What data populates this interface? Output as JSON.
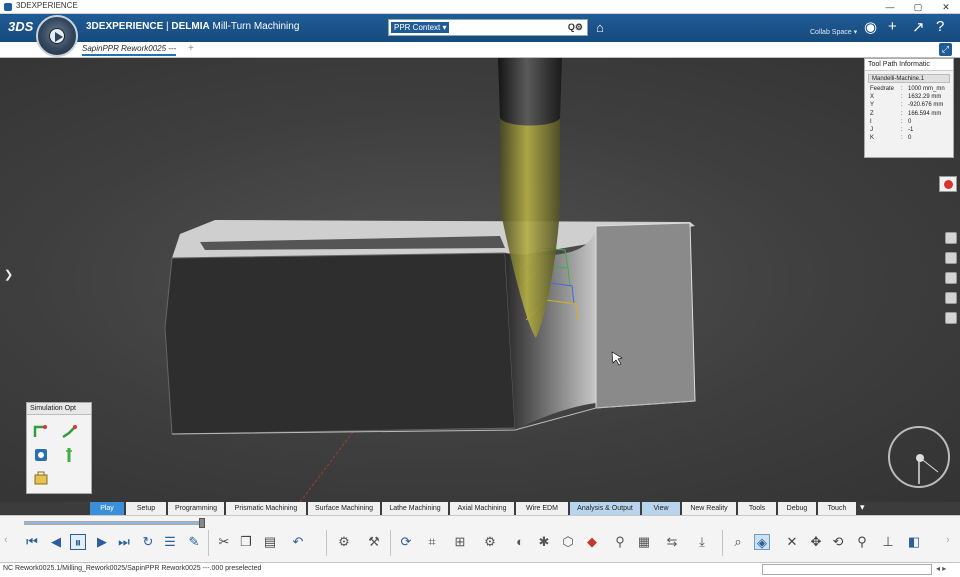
{
  "window": {
    "title": "3DEXPERIENCE",
    "minimize": "—",
    "maximize": "▢",
    "close": "✕"
  },
  "header": {
    "brand_logo": "3DS",
    "brand": "3DEXPERIENCE",
    "separator": " | ",
    "product": "DELMIA",
    "app": " Mill-Turn Machining",
    "search_context": "PPR Context ▾",
    "search_placeholder": "",
    "search_icon": "Q⚙",
    "collab_space": "Collab Space ▾"
  },
  "tabs": {
    "document": "SapinPPR Rework0025 ---",
    "add": "+"
  },
  "tool_path_panel": {
    "title": "Tool Path Informatic",
    "machine": "Mandelli-Machine.1",
    "rows": [
      {
        "label": "Feedrate",
        "colon": ":",
        "value": "1000 mm_mn"
      },
      {
        "label": "X",
        "colon": ":",
        "value": "1632.29 mm"
      },
      {
        "label": "Y",
        "colon": ":",
        "value": "-920.676 mm"
      },
      {
        "label": "Z",
        "colon": ":",
        "value": "166.594 mm"
      },
      {
        "label": "I",
        "colon": ":",
        "value": "0"
      },
      {
        "label": "J",
        "colon": ":",
        "value": "-1"
      },
      {
        "label": "K",
        "colon": ":",
        "value": "0"
      }
    ]
  },
  "simulation_panel": {
    "title": "Simulation Opt"
  },
  "action_tabs": [
    {
      "label": "Play",
      "state": "active"
    },
    {
      "label": "Setup",
      "state": ""
    },
    {
      "label": "Programming",
      "state": ""
    },
    {
      "label": "Prismatic Machining",
      "state": ""
    },
    {
      "label": "Surface Machining",
      "state": ""
    },
    {
      "label": "Lathe Machining",
      "state": ""
    },
    {
      "label": "Axial Machining",
      "state": ""
    },
    {
      "label": "Wire EDM",
      "state": ""
    },
    {
      "label": "Analysis & Output",
      "state": "hl"
    },
    {
      "label": "View",
      "state": "hl"
    },
    {
      "label": "New Reality",
      "state": ""
    },
    {
      "label": "Tools",
      "state": ""
    },
    {
      "label": "Debug",
      "state": ""
    },
    {
      "label": "Touch",
      "state": ""
    }
  ],
  "playback": {
    "progress": 1.0
  },
  "status": {
    "text": "NC Rework0025.1/Milling_Rework0025/SapinPPR Rework0025 ---.000 preselected",
    "input_value": ""
  },
  "colors": {
    "accent": "#1f5c96",
    "active_tab": "#3a8fd8",
    "tool": "#a8a23a"
  }
}
